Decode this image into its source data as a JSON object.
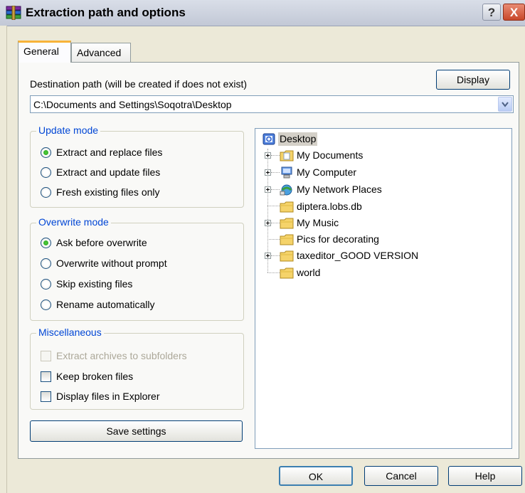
{
  "window": {
    "title": "Extraction path and options",
    "help_glyph": "?",
    "close_glyph": "X"
  },
  "tabs": [
    {
      "label": "General",
      "active": true
    },
    {
      "label": "Advanced",
      "active": false
    }
  ],
  "destination": {
    "label": "Destination path (will be created if does not exist)",
    "display_button": "Display",
    "path": "C:\\Documents and Settings\\Soqotra\\Desktop"
  },
  "update_mode": {
    "title": "Update mode",
    "options": [
      {
        "label": "Extract and replace files",
        "selected": true
      },
      {
        "label": "Extract and update files",
        "selected": false
      },
      {
        "label": "Fresh existing files only",
        "selected": false
      }
    ]
  },
  "overwrite_mode": {
    "title": "Overwrite mode",
    "options": [
      {
        "label": "Ask before overwrite",
        "selected": true
      },
      {
        "label": "Overwrite without prompt",
        "selected": false
      },
      {
        "label": "Skip existing files",
        "selected": false
      },
      {
        "label": "Rename automatically",
        "selected": false
      }
    ]
  },
  "misc": {
    "title": "Miscellaneous",
    "options": [
      {
        "label": "Extract archives to subfolders",
        "checked": false,
        "disabled": true
      },
      {
        "label": "Keep broken files",
        "checked": false,
        "disabled": false
      },
      {
        "label": "Display files in Explorer",
        "checked": false,
        "disabled": false
      }
    ]
  },
  "save_settings_button": "Save settings",
  "tree": {
    "root": "Desktop",
    "items": [
      {
        "label": "My Documents",
        "icon": "documents-folder-icon",
        "expandable": true
      },
      {
        "label": "My Computer",
        "icon": "computer-icon",
        "expandable": true
      },
      {
        "label": "My Network Places",
        "icon": "network-icon",
        "expandable": true
      },
      {
        "label": "diptera.lobs.db",
        "icon": "folder-icon",
        "expandable": false
      },
      {
        "label": "My Music",
        "icon": "music-folder-icon",
        "expandable": true
      },
      {
        "label": "Pics for decorating",
        "icon": "folder-icon",
        "expandable": false
      },
      {
        "label": "taxeditor_GOOD VERSION",
        "icon": "folder-icon",
        "expandable": true
      },
      {
        "label": "world",
        "icon": "folder-icon",
        "expandable": false
      }
    ]
  },
  "footer": {
    "ok": "OK",
    "cancel": "Cancel",
    "help": "Help"
  },
  "colors": {
    "group_title": "#0046d5",
    "tab_highlight": "#f8b339",
    "close_button": "#c8472a"
  }
}
